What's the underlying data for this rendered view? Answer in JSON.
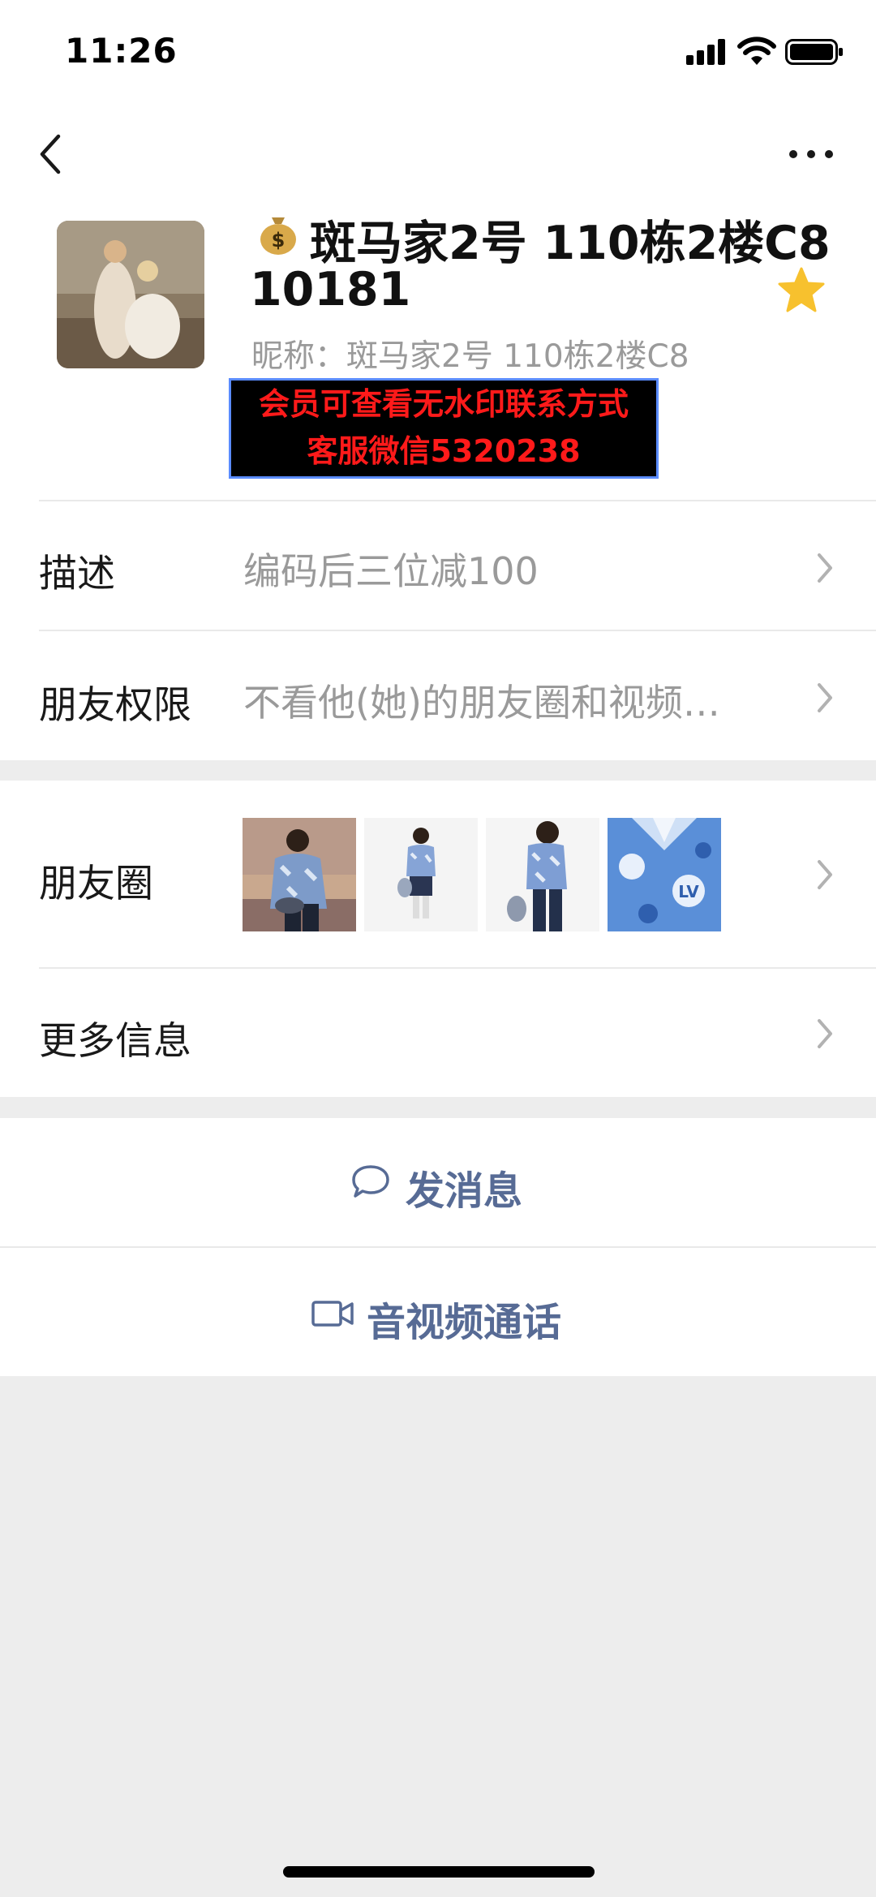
{
  "status_bar": {
    "time": "11:26"
  },
  "profile": {
    "name_line1": "斑马家2号 110栋2楼C8",
    "name_line2": "10181",
    "nickname_label": "昵称：",
    "nickname_value": "斑马家2号 110栋2楼C8",
    "watermark_line1": "会员可查看无水印联系方式",
    "watermark_line2": "客服微信5320238",
    "star_color": "#f7c12e"
  },
  "rows": {
    "description": {
      "label": "描述",
      "value": "编码后三位减100"
    },
    "permissions": {
      "label": "朋友权限",
      "value": "不看他(她)的朋友圈和视频…"
    },
    "moments": {
      "label": "朋友圈"
    },
    "more_info": {
      "label": "更多信息"
    }
  },
  "actions": {
    "message": {
      "label": "发消息"
    },
    "call": {
      "label": "音视频通话"
    }
  },
  "colors": {
    "link": "#576b95",
    "background": "#ededed"
  }
}
